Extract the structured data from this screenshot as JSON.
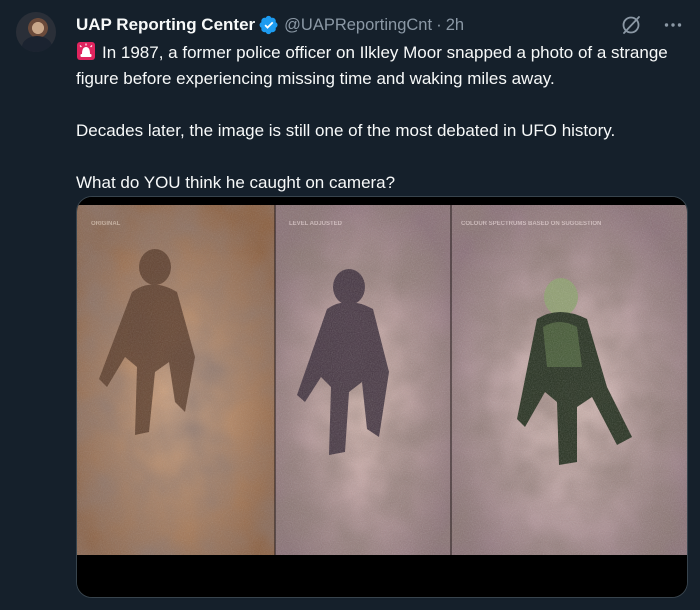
{
  "author": {
    "name": "UAP Reporting Center",
    "handle": "@UAPReportingCnt",
    "separator": "·",
    "time": "2h"
  },
  "icons": {
    "avatar": "profile-avatar",
    "verified": "verified-badge-icon",
    "grok": "grok-slash-icon",
    "more": "more-dots-icon",
    "siren": "police-light-emoji"
  },
  "tweet": {
    "paragraph1": "In 1987, a former police officer on Ilkley Moor snapped a photo of a strange figure before experiencing missing time and waking miles away.",
    "paragraph2": "Decades later, the image is still one of the most debated in UFO history.",
    "paragraph3": "What do YOU think he caught on camera?"
  },
  "media": {
    "panel_labels": [
      "ORIGINAL",
      "LEVEL ADJUSTED",
      "COLOUR SPECTRUMS BASED ON SUGGESTION"
    ]
  },
  "colors": {
    "background": "#15202b",
    "secondary_text": "#8b98a5",
    "verified": "#1d9bf0",
    "border": "#38444d"
  }
}
